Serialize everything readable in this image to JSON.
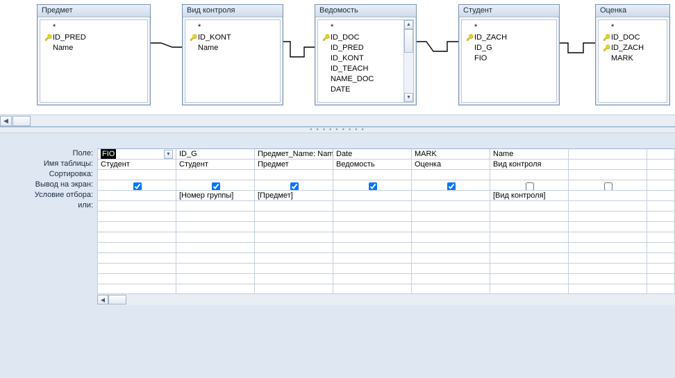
{
  "tables": {
    "predmet": {
      "title": "Предмет",
      "fields": [
        {
          "name": "*",
          "pk": false
        },
        {
          "name": "ID_PRED",
          "pk": true
        },
        {
          "name": "Name",
          "pk": false
        }
      ]
    },
    "vidkont": {
      "title": "Вид контроля",
      "fields": [
        {
          "name": "*",
          "pk": false
        },
        {
          "name": "ID_KONT",
          "pk": true
        },
        {
          "name": "Name",
          "pk": false
        }
      ]
    },
    "vedomost": {
      "title": "Ведомость",
      "fields": [
        {
          "name": "*",
          "pk": false
        },
        {
          "name": "ID_DOC",
          "pk": true
        },
        {
          "name": "ID_PRED",
          "pk": false
        },
        {
          "name": "ID_KONT",
          "pk": false
        },
        {
          "name": "ID_TEACH",
          "pk": false
        },
        {
          "name": "NAME_DOC",
          "pk": false
        },
        {
          "name": "DATE",
          "pk": false
        }
      ]
    },
    "student": {
      "title": "Студент",
      "fields": [
        {
          "name": "*",
          "pk": false
        },
        {
          "name": "ID_ZACH",
          "pk": true
        },
        {
          "name": "ID_G",
          "pk": false
        },
        {
          "name": "FIO",
          "pk": false
        }
      ]
    },
    "ocenka": {
      "title": "Оценка",
      "fields": [
        {
          "name": "*",
          "pk": false
        },
        {
          "name": "ID_DOC",
          "pk": true
        },
        {
          "name": "ID_ZACH",
          "pk": true
        },
        {
          "name": "MARK",
          "pk": false
        }
      ]
    }
  },
  "qbe": {
    "labels": {
      "field": "Поле:",
      "table": "Имя таблицы:",
      "sort": "Сортировка:",
      "show": "Вывод на экран:",
      "criteria": "Условие отбора:",
      "or": "или:"
    },
    "columns": [
      {
        "field": "FIO",
        "table": "Студент",
        "sort": "",
        "show": true,
        "criteria": "",
        "selected": true
      },
      {
        "field": "ID_G",
        "table": "Студент",
        "sort": "",
        "show": true,
        "criteria": "[Номер группы]"
      },
      {
        "field": "Предмет_Name: Nam",
        "table": "Предмет",
        "sort": "",
        "show": true,
        "criteria": "[Предмет]"
      },
      {
        "field": "Date",
        "table": "Ведомость",
        "sort": "",
        "show": true,
        "criteria": ""
      },
      {
        "field": "MARK",
        "table": "Оценка",
        "sort": "",
        "show": true,
        "criteria": ""
      },
      {
        "field": "Name",
        "table": "Вид контроля",
        "sort": "",
        "show": false,
        "criteria": "[Вид контроля]"
      },
      {
        "field": "",
        "table": "",
        "sort": "",
        "show": false,
        "criteria": ""
      }
    ]
  }
}
